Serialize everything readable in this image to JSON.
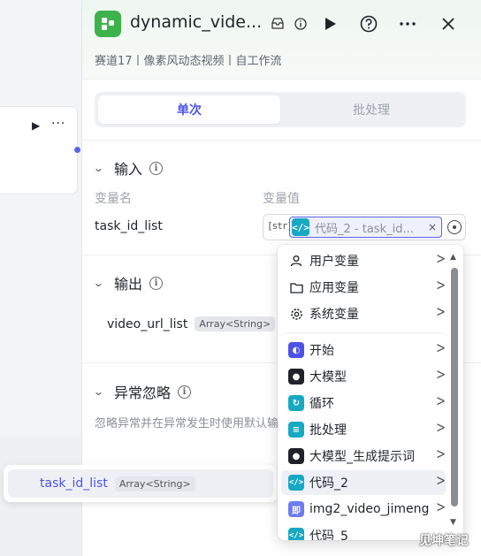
{
  "app": {
    "title": "dynamic_vide...",
    "subtitle": "赛道17丨像素风动态视频丨自工作流"
  },
  "tabs": [
    {
      "label": "单次",
      "active": true
    },
    {
      "label": "批处理",
      "active": false
    }
  ],
  "input_section": {
    "title": "输入",
    "col_name": "变量名",
    "col_value": "变量值",
    "param_name": "task_id_list",
    "type_tag": "[str]",
    "ref_text": "代码_2 - task_id...",
    "ref_clear": "×"
  },
  "output_section": {
    "title": "输出",
    "var_name": "video_url_list",
    "var_type": "Array<String>"
  },
  "ignore_section": {
    "title": "异常忽略",
    "description": "忽略异常并在异常发生时使用默认输出替代"
  },
  "canvas": {
    "chip_name": "task_id_list",
    "chip_type": "Array<String>"
  },
  "dropdown": {
    "items": [
      {
        "label": "用户变量",
        "icon": "user-icon"
      },
      {
        "label": "应用变量",
        "icon": "folder-icon"
      },
      {
        "label": "系统变量",
        "icon": "gear-icon"
      },
      {
        "label": "开始",
        "icon": "start-node-icon",
        "color": "#4d53e8"
      },
      {
        "label": "大模型",
        "icon": "llm-node-icon",
        "color": "#1f2329"
      },
      {
        "label": "循环",
        "icon": "loop-node-icon",
        "color": "#17a9c2"
      },
      {
        "label": "批处理",
        "icon": "batch-node-icon",
        "color": "#17a9c2"
      },
      {
        "label": "大模型_生成提示词",
        "icon": "llm-node-icon",
        "color": "#1f2329"
      },
      {
        "label": "代码_2",
        "icon": "code-node-icon",
        "color": "#17a9c2",
        "selected": true
      },
      {
        "label": "img2_video_jimeng",
        "icon": "plugin-node-icon",
        "color": "#6e7bf2"
      },
      {
        "label": "代码_5",
        "icon": "code-node-icon",
        "color": "#17a9c2"
      }
    ]
  },
  "watermark": "见坤笔记"
}
